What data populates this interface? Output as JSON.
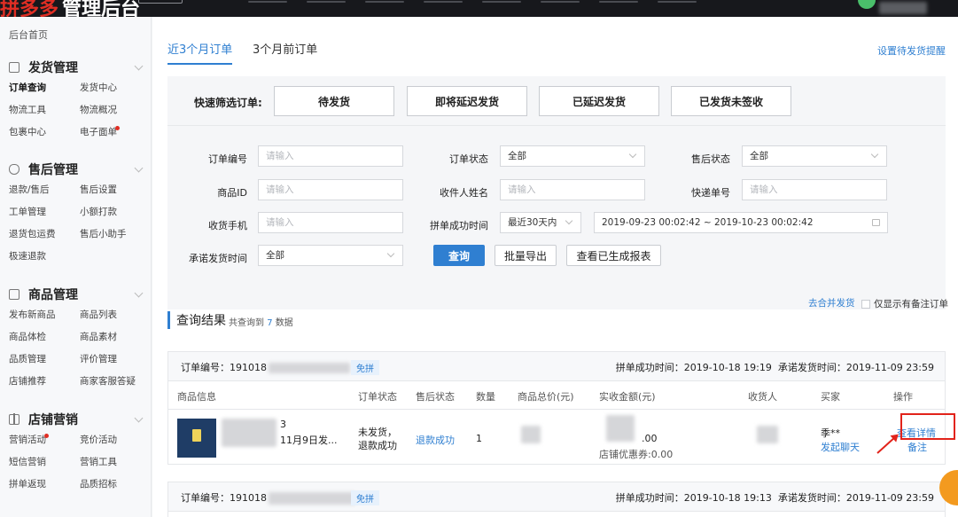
{
  "topbar": {
    "logo_mark": "拼多多",
    "logo_rest": "管理后台"
  },
  "sidebar": {
    "home": "后台首页",
    "sections": [
      {
        "title": "发货管理",
        "icon": "list-icon",
        "items": [
          "订单查询",
          "发货中心",
          "物流工具",
          "物流概况",
          "包裹中心",
          "电子面单"
        ],
        "active": "订单查询",
        "dot": "电子面单"
      },
      {
        "title": "售后管理",
        "icon": "shield-icon",
        "items": [
          "退款/售后",
          "售后设置",
          "工单管理",
          "小额打款",
          "退货包运费",
          "售后小助手",
          "极速退款"
        ]
      },
      {
        "title": "商品管理",
        "icon": "box-icon",
        "items": [
          "发布新商品",
          "商品列表",
          "商品体检",
          "商品素材",
          "品质管理",
          "评价管理",
          "店铺推荐",
          "商家客服答疑"
        ]
      },
      {
        "title": "店铺营销",
        "icon": "gift-icon",
        "items": [
          "营销活动",
          "竞价活动",
          "短信营销",
          "营销工具",
          "拼单返现",
          "品质招标"
        ],
        "dot": "营销活动"
      }
    ]
  },
  "tabs": {
    "recent": "近3个月订单",
    "older": "3个月前订单",
    "reminder_link": "设置待发货提醒"
  },
  "quick_filter": {
    "label": "快速筛选订单:",
    "buttons": [
      "待发货",
      "即将延迟发货",
      "已延迟发货",
      "已发货未签收"
    ]
  },
  "form": {
    "order_no": {
      "label": "订单编号",
      "placeholder": "请输入"
    },
    "order_status": {
      "label": "订单状态",
      "value": "全部"
    },
    "aftersale_status": {
      "label": "售后状态",
      "value": "全部"
    },
    "goods_id": {
      "label": "商品ID",
      "placeholder": "请输入"
    },
    "receiver_name": {
      "label": "收件人姓名",
      "placeholder": "请输入"
    },
    "tracking_no": {
      "label": "快递单号",
      "placeholder": "请输入"
    },
    "phone": {
      "label": "收货手机",
      "placeholder": "请输入"
    },
    "group_time": {
      "label": "拼单成功时间",
      "value": "最近30天内"
    },
    "date_range": "2019-09-23 00:02:42 ~ 2019-10-23 00:02:42",
    "promise_time": {
      "label": "承诺发货时间",
      "value": "全部"
    },
    "search_btn": "查询",
    "export_btn": "批量导出",
    "report_btn": "查看已生成报表"
  },
  "merge_link": "去合并发货",
  "only_remarked": "仅显示有备注订单",
  "results": {
    "title": "查询结果",
    "count_prefix": "共查询到",
    "count": "7",
    "count_suffix": "数据"
  },
  "table_headers": [
    "商品信息",
    "订单状态",
    "售后状态",
    "数量",
    "商品总价(元)",
    "实收金额(元)",
    "收货人",
    "买家",
    "操作"
  ],
  "orders": [
    {
      "no_prefix": "订单编号：191018",
      "tag": "免拼",
      "group_time": "拼单成功时间：2019-10-18 19:19",
      "promise_time": "承诺发货时间：2019-11-09 23:59",
      "goods_frag1": "3",
      "goods_frag2": "11月9日发...",
      "status": "未发货，退款成功",
      "aftersale": "退款成功",
      "qty": "1",
      "paid_frag": ".00",
      "coupon": "店铺优惠券:0.00",
      "buyer": "季**",
      "chat": "发起聊天",
      "detail": "查看详情",
      "remark": "备注"
    },
    {
      "no_prefix": "订单编号：191018",
      "tag": "免拼",
      "group_time": "拼单成功时间：2019-10-18 19:13",
      "promise_time": "承诺发货时间：2019-11-09 23:59"
    }
  ],
  "colors": {
    "accent": "#2f7fd1",
    "brand": "#e02e24",
    "highlight": "#e2231a"
  }
}
